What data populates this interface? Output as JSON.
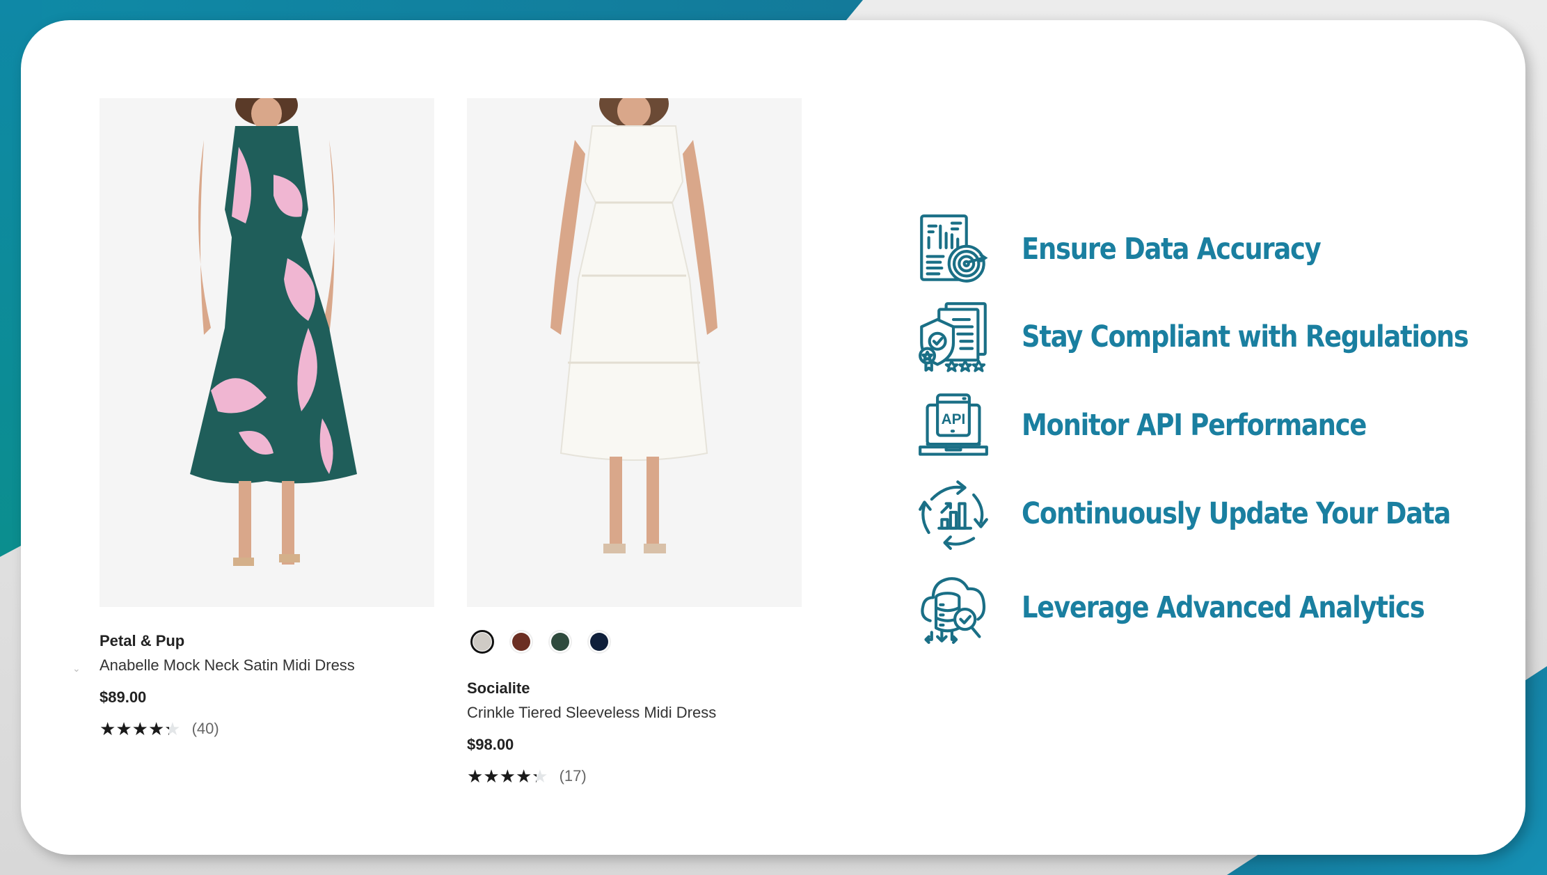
{
  "theme": {
    "accent": "#1a7fa0",
    "icon_color": "#1a6f86",
    "text_dark": "#222222"
  },
  "products": [
    {
      "brand": "Petal & Pup",
      "name": "Anabelle Mock Neck Satin Midi Dress",
      "price": "$89.00",
      "rating": 4.5,
      "review_count": "(40)",
      "image_alt": "Green and pink floral satin halter midi dress",
      "swatches": []
    },
    {
      "brand": "Socialite",
      "name": "Crinkle Tiered Sleeveless Midi Dress",
      "price": "$98.00",
      "rating": 4.5,
      "review_count": "(17)",
      "image_alt": "White crinkle tiered sleeveless midi dress",
      "swatches": [
        {
          "color": "#cfcbc5",
          "selected": true
        },
        {
          "color": "#6b2e22",
          "selected": false
        },
        {
          "color": "#2f4a3d",
          "selected": false
        },
        {
          "color": "#0f1f3a",
          "selected": false
        }
      ]
    }
  ],
  "features": [
    {
      "icon": "report-target-icon",
      "label": "Ensure Data Accuracy"
    },
    {
      "icon": "compliance-shield-icon",
      "label": "Stay Compliant with Regulations"
    },
    {
      "icon": "api-laptop-icon",
      "label": "Monitor API Performance"
    },
    {
      "icon": "refresh-chart-icon",
      "label": "Continuously Update Your Data"
    },
    {
      "icon": "cloud-database-analytics-icon",
      "label": "Leverage Advanced Analytics"
    }
  ]
}
